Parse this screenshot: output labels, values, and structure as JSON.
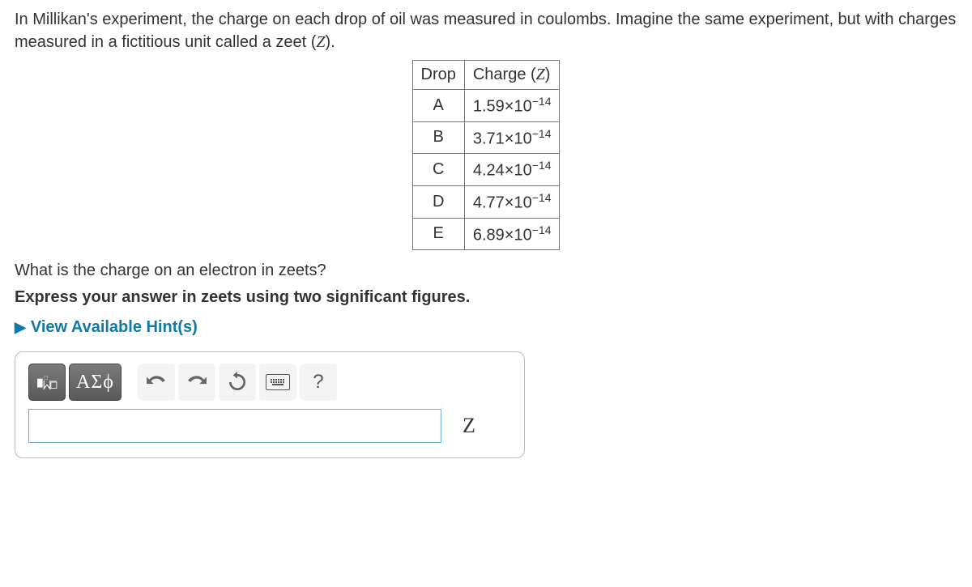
{
  "problem": {
    "intro": "In Millikan's experiment, the charge on each drop of oil was measured in coulombs. Imagine the same experiment, but with charges measured in a fictitious unit called a zeet (",
    "intro_unit": "Z",
    "intro_close": ")."
  },
  "table": {
    "headers": {
      "drop": "Drop",
      "charge_pre": "Charge (",
      "charge_unit": "Z",
      "charge_post": ")"
    },
    "rows": [
      {
        "drop": "A",
        "mantissa": "1.59",
        "exp": "−14"
      },
      {
        "drop": "B",
        "mantissa": "3.71",
        "exp": "−14"
      },
      {
        "drop": "C",
        "mantissa": "4.24",
        "exp": "−14"
      },
      {
        "drop": "D",
        "mantissa": "4.77",
        "exp": "−14"
      },
      {
        "drop": "E",
        "mantissa": "6.89",
        "exp": "−14"
      }
    ]
  },
  "question": "What is the charge on an electron in zeets?",
  "instruction": "Express your answer in zeets using two significant figures.",
  "hints_label": "View Available Hint(s)",
  "toolbar": {
    "greek_label": "ΑΣϕ",
    "help_label": "?"
  },
  "answer": {
    "value": "",
    "unit": "Z"
  }
}
